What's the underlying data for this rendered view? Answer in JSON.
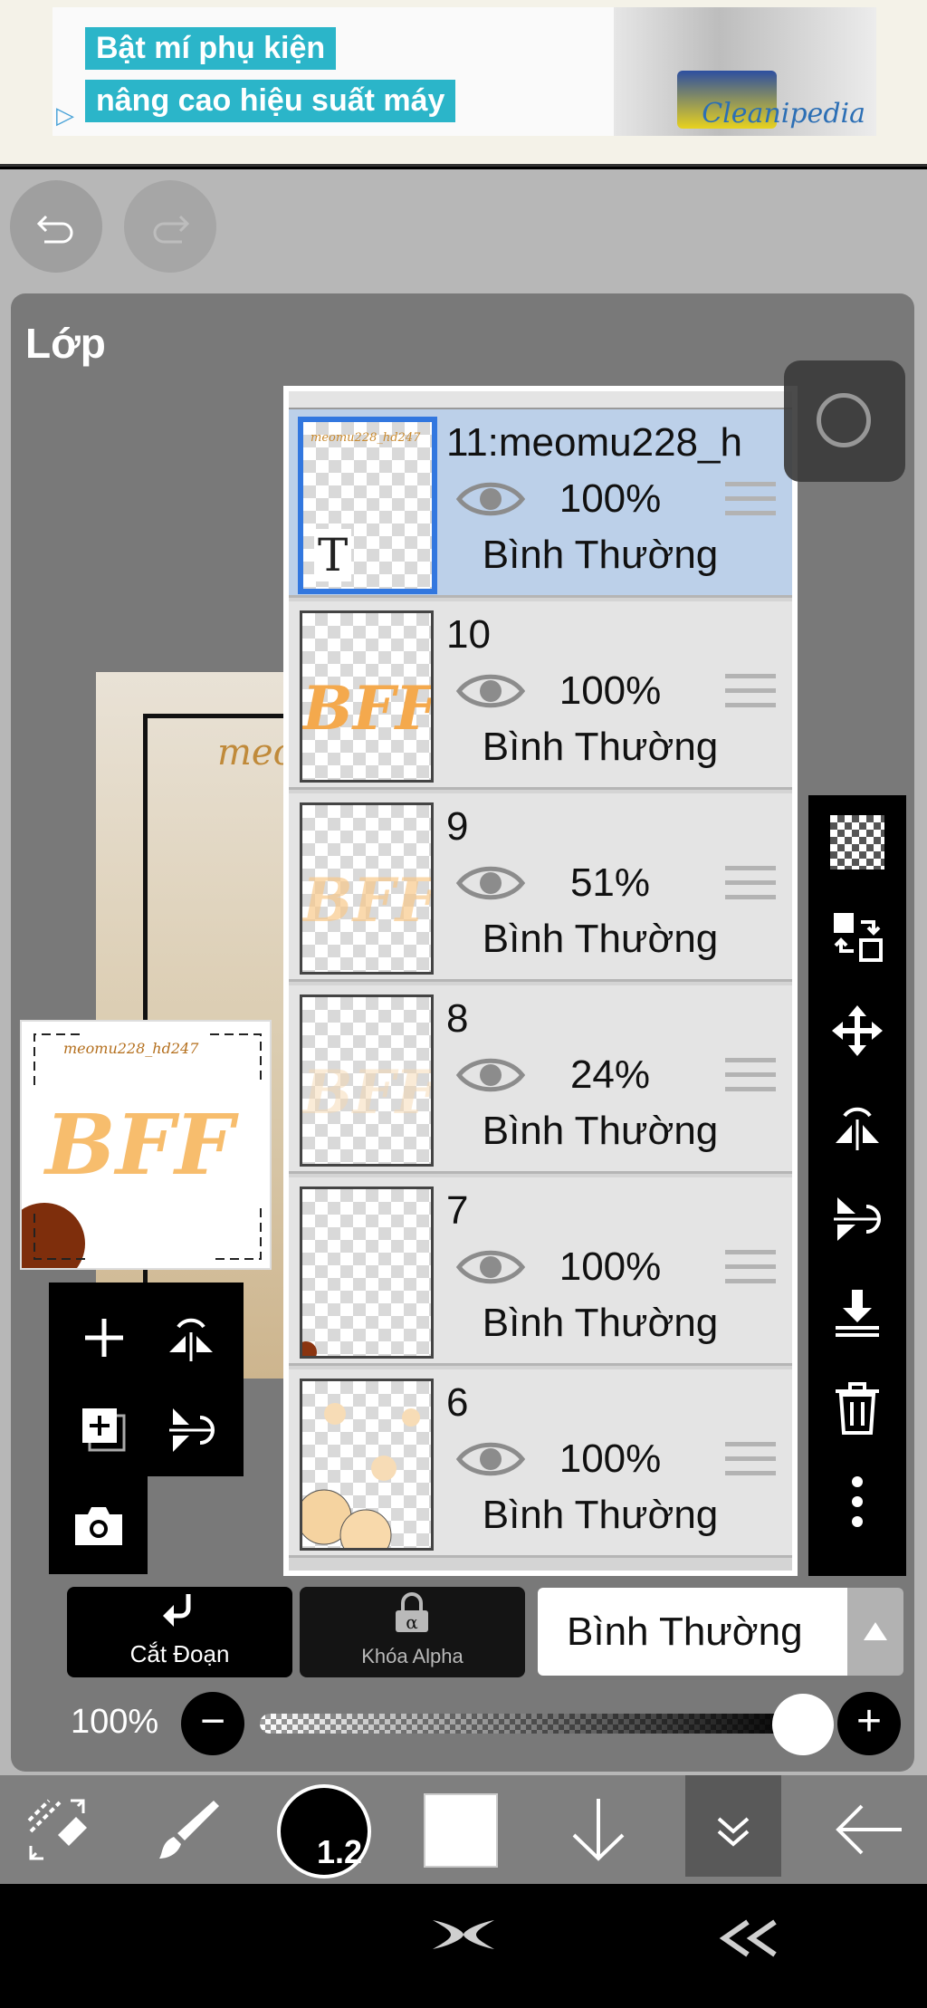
{
  "ad": {
    "line1": "Bật mí phụ kiện",
    "line2": "nâng cao hiệu suất máy",
    "brand": "Cleanipedia"
  },
  "panel": {
    "title": "Lớp"
  },
  "layers": [
    {
      "name": "11:meomu228_h",
      "opacity": "100%",
      "blend": "Bình Thường",
      "selected": true,
      "icon": "text-layer-icon"
    },
    {
      "name": "10",
      "opacity": "100%",
      "blend": "Bình Thường"
    },
    {
      "name": "9",
      "opacity": "51%",
      "blend": "Bình Thường"
    },
    {
      "name": "8",
      "opacity": "24%",
      "blend": "Bình Thường"
    },
    {
      "name": "7",
      "opacity": "100%",
      "blend": "Bình Thường"
    },
    {
      "name": "6",
      "opacity": "100%",
      "blend": "Bình Thường"
    }
  ],
  "thumbnail": {
    "signature": "meomu228_hd247",
    "art_text": "BFF"
  },
  "controls": {
    "clip_label": "Cắt Đoạn",
    "alpha_lock_label": "Khóa Alpha",
    "blend_mode": "Bình Thường",
    "opacity_label": "100%",
    "opacity_value": 1.0,
    "brush_size": "1.2"
  },
  "colors": {
    "accent": "#3277df",
    "panel": "#797979",
    "selected_row": "#bcd0e9",
    "ad_accent": "#2bb5c9"
  }
}
